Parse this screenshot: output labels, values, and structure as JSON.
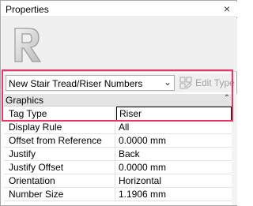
{
  "window": {
    "title": "Properties",
    "close_glyph": "×"
  },
  "type_preview": {
    "logo_letter": "R",
    "logo_icon": "revit-r-icon"
  },
  "selector": {
    "selected": "New Stair Tread/Riser Numbers",
    "edit_type_label": "Edit Type",
    "edit_type_icon": "edit-type-icon"
  },
  "grid": {
    "group": {
      "label": "Graphics",
      "collapse_icon": "collapse-icon"
    },
    "rows": [
      {
        "name": "Tag Type",
        "value": "Riser"
      },
      {
        "name": "Display Rule",
        "value": "All"
      },
      {
        "name": "Offset from Reference",
        "value": "0.0000 mm"
      },
      {
        "name": "Justify",
        "value": "Back"
      },
      {
        "name": "Justify Offset",
        "value": "0.0000 mm"
      },
      {
        "name": "Orientation",
        "value": "Horizontal"
      },
      {
        "name": "Number Size",
        "value": "1.1906 mm"
      }
    ]
  },
  "highlight_color": "#e8366a"
}
